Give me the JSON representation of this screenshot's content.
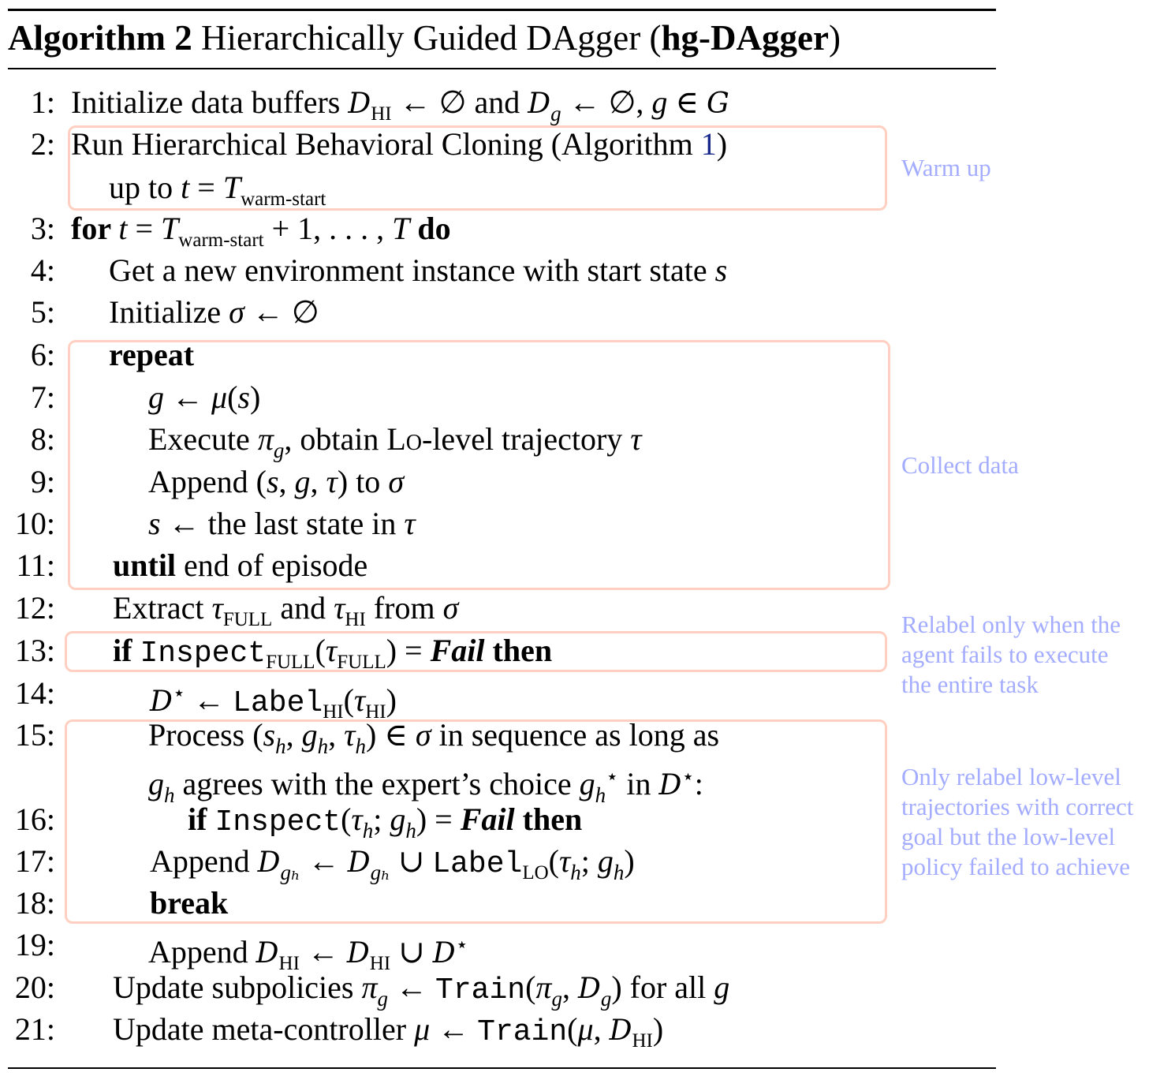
{
  "title": {
    "label": "Algorithm 2",
    "name": " Hierarchically Guided DAgger (",
    "short": "hg-DAgger",
    "close": ")"
  },
  "colors": {
    "box_border": "#ffd0c2",
    "annotation": "#a3acff",
    "link": "#1a2a8c"
  },
  "lines": [
    {
      "num": "1:",
      "level": 0,
      "segs": [
        [
          "n",
          "Initialize data buffers "
        ],
        [
          "cal",
          "D"
        ],
        [
          "sub",
          "HI"
        ],
        [
          "n",
          " ← ∅ and "
        ],
        [
          "cal",
          "D"
        ],
        [
          "isub",
          "g"
        ],
        [
          "n",
          " ← ∅, "
        ],
        [
          "i",
          "g"
        ],
        [
          "n",
          " ∈ "
        ],
        [
          "cal",
          "G"
        ]
      ]
    },
    {
      "num": "2:",
      "level": 0,
      "segs": [
        [
          "n",
          "Run Hierarchical Behavioral Cloning (Algorithm "
        ],
        [
          "link",
          "1"
        ],
        [
          "n",
          ")"
        ]
      ]
    },
    {
      "num": "",
      "level": 1,
      "segs": [
        [
          "n",
          "up to "
        ],
        [
          "i",
          "t"
        ],
        [
          "n",
          " = "
        ],
        [
          "i",
          "T"
        ],
        [
          "sub",
          "warm-start"
        ]
      ]
    },
    {
      "num": "3:",
      "level": 0,
      "segs": [
        [
          "b",
          "for "
        ],
        [
          "i",
          "t"
        ],
        [
          "n",
          " = "
        ],
        [
          "i",
          "T"
        ],
        [
          "sub",
          "warm-start"
        ],
        [
          "n",
          " + 1, . . . , "
        ],
        [
          "i",
          "T"
        ],
        [
          "b",
          " do"
        ]
      ]
    },
    {
      "num": "4:",
      "level": 1,
      "segs": [
        [
          "n",
          "Get a new environment instance with start state "
        ],
        [
          "i",
          "s"
        ]
      ]
    },
    {
      "num": "5:",
      "level": 1,
      "segs": [
        [
          "n",
          "Initialize "
        ],
        [
          "i",
          "σ"
        ],
        [
          "n",
          " ← ∅"
        ]
      ]
    },
    {
      "num": "6:",
      "level": 1,
      "segs": [
        [
          "b",
          "repeat"
        ]
      ]
    },
    {
      "num": "7:",
      "level": 2,
      "segs": [
        [
          "i",
          "g"
        ],
        [
          "n",
          " ← "
        ],
        [
          "i",
          "μ"
        ],
        [
          "n",
          "("
        ],
        [
          "i",
          "s"
        ],
        [
          "n",
          ")"
        ]
      ]
    },
    {
      "num": "8:",
      "level": 2,
      "segs": [
        [
          "n",
          "Execute "
        ],
        [
          "i",
          "π"
        ],
        [
          "isub",
          "g"
        ],
        [
          "n",
          ", obtain "
        ],
        [
          "sc",
          "Lo"
        ],
        [
          "n",
          "-level trajectory "
        ],
        [
          "i",
          "τ"
        ]
      ]
    },
    {
      "num": "9:",
      "level": 2,
      "segs": [
        [
          "n",
          "Append ("
        ],
        [
          "i",
          "s"
        ],
        [
          "n",
          ", "
        ],
        [
          "i",
          "g"
        ],
        [
          "n",
          ", "
        ],
        [
          "i",
          "τ"
        ],
        [
          "n",
          ") to "
        ],
        [
          "i",
          "σ"
        ]
      ]
    },
    {
      "num": "10:",
      "level": 2,
      "segs": [
        [
          "i",
          "s"
        ],
        [
          "n",
          " ← the last state in "
        ],
        [
          "i",
          "τ"
        ]
      ]
    },
    {
      "num": "11:",
      "level": 1,
      "segs": [
        [
          "b",
          "until"
        ],
        [
          "n",
          " end of episode"
        ]
      ]
    },
    {
      "num": "12:",
      "level": 1,
      "segs": [
        [
          "n",
          "Extract "
        ],
        [
          "i",
          "τ"
        ],
        [
          "sub",
          "FULL"
        ],
        [
          "n",
          " and "
        ],
        [
          "i",
          "τ"
        ],
        [
          "sub",
          "HI"
        ],
        [
          "n",
          " from "
        ],
        [
          "i",
          "σ"
        ]
      ]
    },
    {
      "num": "13:",
      "level": 1,
      "segs": [
        [
          "b",
          "if "
        ],
        [
          "m",
          "Inspect"
        ],
        [
          "sub",
          "FULL"
        ],
        [
          "n",
          "("
        ],
        [
          "i",
          "τ"
        ],
        [
          "sub",
          "FULL"
        ],
        [
          "n",
          ") = "
        ],
        [
          "bi",
          "Fail"
        ],
        [
          "b",
          " then"
        ]
      ]
    },
    {
      "num": "14:",
      "level": 2,
      "segs": [
        [
          "cal",
          "D"
        ],
        [
          "sup",
          "⋆"
        ],
        [
          "n",
          " ← "
        ],
        [
          "m",
          "Label"
        ],
        [
          "sub",
          "HI"
        ],
        [
          "n",
          "("
        ],
        [
          "i",
          "τ"
        ],
        [
          "sub",
          "HI"
        ],
        [
          "n",
          ")"
        ]
      ]
    },
    {
      "num": "15:",
      "level": 2,
      "segs": [
        [
          "n",
          "Process ("
        ],
        [
          "i",
          "s"
        ],
        [
          "isub",
          "h"
        ],
        [
          "n",
          ", "
        ],
        [
          "i",
          "g"
        ],
        [
          "isub",
          "h"
        ],
        [
          "n",
          ", "
        ],
        [
          "i",
          "τ"
        ],
        [
          "isub",
          "h"
        ],
        [
          "n",
          ") ∈ "
        ],
        [
          "i",
          "σ"
        ],
        [
          "n",
          " in sequence as long as"
        ]
      ]
    },
    {
      "num": "",
      "level": 2,
      "segs": [
        [
          "i",
          "g"
        ],
        [
          "isub",
          "h"
        ],
        [
          "n",
          " agrees with the expert’s choice "
        ],
        [
          "i",
          "g"
        ],
        [
          "isub",
          "h"
        ],
        [
          "sup",
          "⋆"
        ],
        [
          "n",
          " in "
        ],
        [
          "cal",
          "D"
        ],
        [
          "sup",
          "⋆"
        ],
        [
          "n",
          ":"
        ]
      ]
    },
    {
      "num": "16:",
      "level": 3,
      "segs": [
        [
          "b",
          "if "
        ],
        [
          "m",
          "Inspect"
        ],
        [
          "n",
          "("
        ],
        [
          "i",
          "τ"
        ],
        [
          "isub",
          "h"
        ],
        [
          "n",
          "; "
        ],
        [
          "i",
          "g"
        ],
        [
          "isub",
          "h"
        ],
        [
          "n",
          ") = "
        ],
        [
          "bi",
          "Fail"
        ],
        [
          "b",
          " then"
        ]
      ]
    },
    {
      "num": "17:",
      "level": 4,
      "segs": [
        [
          "n",
          "Append "
        ],
        [
          "cal",
          "D"
        ],
        [
          "isub",
          "gₕ"
        ],
        [
          "n",
          " ← "
        ],
        [
          "cal",
          "D"
        ],
        [
          "isub",
          "gₕ"
        ],
        [
          "n",
          " ∪ "
        ],
        [
          "m",
          "Label"
        ],
        [
          "sub",
          "LO"
        ],
        [
          "n",
          "("
        ],
        [
          "i",
          "τ"
        ],
        [
          "isub",
          "h"
        ],
        [
          "n",
          "; "
        ],
        [
          "i",
          "g"
        ],
        [
          "isub",
          "h"
        ],
        [
          "n",
          ")"
        ]
      ]
    },
    {
      "num": "18:",
      "level": 4,
      "segs": [
        [
          "b",
          "break"
        ]
      ]
    },
    {
      "num": "19:",
      "level": 2,
      "segs": [
        [
          "n",
          "Append "
        ],
        [
          "cal",
          "D"
        ],
        [
          "sub",
          "HI"
        ],
        [
          "n",
          " ← "
        ],
        [
          "cal",
          "D"
        ],
        [
          "sub",
          "HI"
        ],
        [
          "n",
          " ∪ "
        ],
        [
          "cal",
          "D"
        ],
        [
          "sup",
          "⋆"
        ]
      ]
    },
    {
      "num": "20:",
      "level": 1,
      "segs": [
        [
          "n",
          "Update subpolicies "
        ],
        [
          "i",
          "π"
        ],
        [
          "isub",
          "g"
        ],
        [
          "n",
          " ← "
        ],
        [
          "m",
          "Train"
        ],
        [
          "n",
          "("
        ],
        [
          "i",
          "π"
        ],
        [
          "isub",
          "g"
        ],
        [
          "n",
          ", "
        ],
        [
          "cal",
          "D"
        ],
        [
          "isub",
          "g"
        ],
        [
          "n",
          ") for all "
        ],
        [
          "i",
          "g"
        ]
      ]
    },
    {
      "num": "21:",
      "level": 1,
      "segs": [
        [
          "n",
          "Update meta-controller "
        ],
        [
          "i",
          "μ"
        ],
        [
          "n",
          " ← "
        ],
        [
          "m",
          "Train"
        ],
        [
          "n",
          "("
        ],
        [
          "i",
          "μ"
        ],
        [
          "n",
          ", "
        ],
        [
          "cal",
          "D"
        ],
        [
          "sub",
          "HI"
        ],
        [
          "n",
          ")"
        ]
      ]
    }
  ],
  "annotations": {
    "warm_up": [
      "Warm up"
    ],
    "collect": [
      "Collect data"
    ],
    "relabel": [
      "Relabel only when the",
      "agent fails to execute",
      "the entire task"
    ],
    "only_relabel": [
      "Only relabel low-level",
      "trajectories with correct",
      "goal but the low-level",
      "policy failed to achieve"
    ]
  }
}
